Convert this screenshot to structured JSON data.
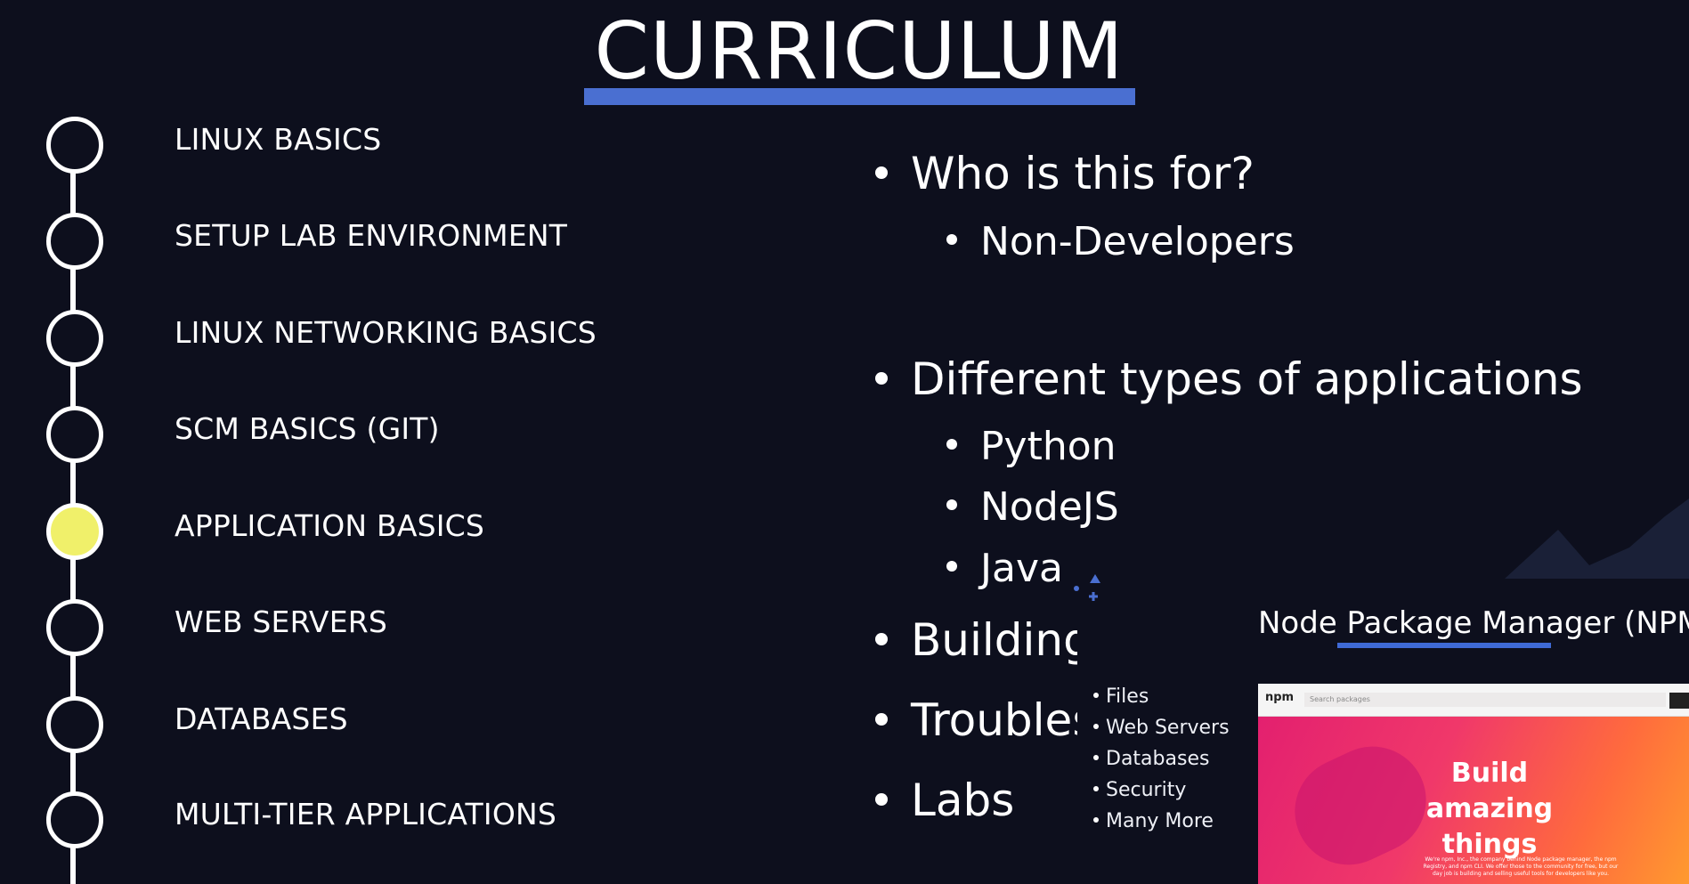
{
  "slide": {
    "title": "CURRICULUM"
  },
  "timeline": [
    {
      "label": "LINUX BASICS",
      "active": false
    },
    {
      "label": "SETUP LAB ENVIRONMENT",
      "active": false
    },
    {
      "label": "LINUX NETWORKING BASICS",
      "active": false
    },
    {
      "label": "SCM BASICS (GIT)",
      "active": false
    },
    {
      "label": "APPLICATION BASICS",
      "active": true
    },
    {
      "label": "WEB SERVERS",
      "active": false
    },
    {
      "label": "DATABASES",
      "active": false
    },
    {
      "label": "MULTI-TIER APPLICATIONS",
      "active": false
    }
  ],
  "bullets": {
    "who": "Who is this for?",
    "who_sub": "Non-Developers",
    "types": "Different types of applications",
    "types_sub": [
      "Python",
      "NodeJS",
      "Java"
    ],
    "building": "Building",
    "trouble": "Troubleshooting",
    "labs": "Labs"
  },
  "sub_list": [
    "Files",
    "Web Servers",
    "Databases",
    "Security",
    "Many More"
  ],
  "npm": {
    "heading": "Node Package Manager (NPM)",
    "logo": "npm",
    "search_placeholder": "Search packages",
    "hero": "Build amazing things",
    "hero_small": "We're npm, Inc., the company behind Node package manager, the npm Registry, and npm CLI. We offer those to the community for free, but our day job is building and selling useful tools for developers like you."
  },
  "colors": {
    "background": "#0d0f1d",
    "accent": "#4a6fd1",
    "active_node": "#f0f06a"
  }
}
